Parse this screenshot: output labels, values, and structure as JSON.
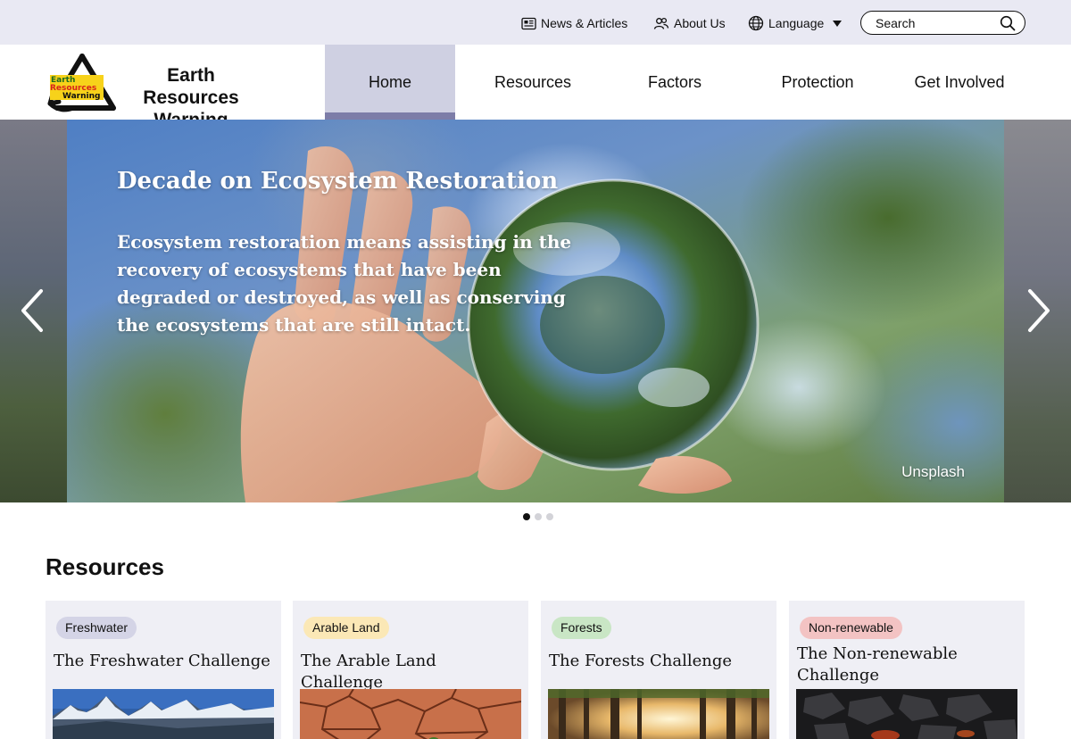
{
  "topbar": {
    "news_label": "News & Articles",
    "about_label": "About Us",
    "language_label": "Language",
    "search_placeholder": "Search"
  },
  "brand": {
    "logo_text": [
      "Earth",
      "Resources",
      "Warning"
    ],
    "name": "Earth Resources Warning"
  },
  "nav": {
    "items": [
      {
        "label": "Home",
        "active": true
      },
      {
        "label": "Resources"
      },
      {
        "label": "Factors"
      },
      {
        "label": "Protection"
      },
      {
        "label": "Get Involved"
      }
    ]
  },
  "hero": {
    "title": "Decade on Ecosystem Restoration",
    "description": "Ecosystem restoration means assisting in the recovery of ecosystems that have been degraded or destroyed, as well as conserving the ecosystems that are still intact.",
    "credit": "Unsplash",
    "slide_count": 3,
    "active_slide": 1
  },
  "resources": {
    "heading": "Resources",
    "cards": [
      {
        "tag": "Freshwater",
        "tag_color": "#d4d4e6",
        "title": "The Freshwater Challenge",
        "icon": "mountain-lake-image"
      },
      {
        "tag": "Arable Land",
        "tag_color": "#fbe8b6",
        "title": "The Arable Land Challenge",
        "icon": "cracked-soil-image"
      },
      {
        "tag": "Forests",
        "tag_color": "#c9e6c5",
        "title": "The Forests Challenge",
        "icon": "forest-image"
      },
      {
        "tag": "Non-renewable",
        "tag_color": "#f3c3c3",
        "title": "The Non-renewable Challenge",
        "icon": "coal-image"
      }
    ]
  },
  "colors": {
    "topbar_bg": "#e9e9f3",
    "nav_active_bg": "#cfd0e2",
    "nav_active_bar": "#7d7da8",
    "card_bg": "#efeff5"
  }
}
